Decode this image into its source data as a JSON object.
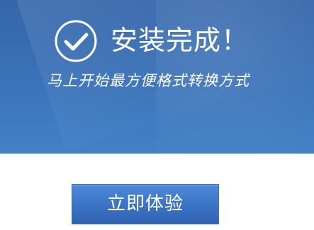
{
  "header": {
    "icon": "check-circle-icon",
    "title": "安装完成！",
    "subtitle": "马上开始最方便格式转换方式"
  },
  "actions": {
    "start_label": "立即体验"
  },
  "colors": {
    "banner": "#3b73b9",
    "button": "#3d74c6",
    "text": "#ffffff"
  }
}
